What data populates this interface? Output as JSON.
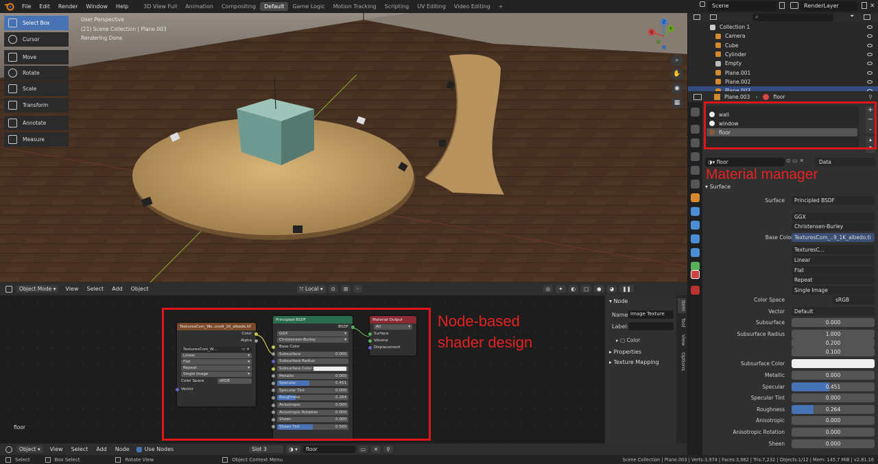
{
  "topbar": {
    "menus": [
      "File",
      "Edit",
      "Render",
      "Window",
      "Help"
    ],
    "workspaces": [
      "3D View Full",
      "Animation",
      "Compositing",
      "Default",
      "Game Logic",
      "Motion Tracking",
      "Scripting",
      "UV Editing",
      "Video Editing"
    ],
    "active_workspace": "Default",
    "add_tab": "+",
    "scene": "Scene",
    "render_layer": "RenderLayer"
  },
  "toolbar": {
    "tools": [
      "Select Box",
      "Cursor",
      "Move",
      "Rotate",
      "Scale",
      "Transform",
      "Annotate",
      "Measure"
    ],
    "active": "Select Box"
  },
  "viewport": {
    "perspective": "User Perspective",
    "collection": "(21) Scene Collection | Plane.003",
    "status": "Rendering Done",
    "gizmo_axes": [
      "Z",
      "Y",
      "X"
    ]
  },
  "viewport_header": {
    "mode": "Object Mode",
    "menus": [
      "View",
      "Select",
      "Add",
      "Object"
    ],
    "orientation": "Local"
  },
  "outliner": {
    "items": [
      {
        "name": "Collection 1"
      },
      {
        "name": "Camera"
      },
      {
        "name": "Cube"
      },
      {
        "name": "Cylinder"
      },
      {
        "name": "Empty"
      },
      {
        "name": "Plane.001"
      },
      {
        "name": "Plane.002"
      },
      {
        "name": "Plane.003"
      }
    ],
    "selected": "Plane.003"
  },
  "properties": {
    "object": "Plane.003",
    "material": "floor",
    "slots": [
      "wall",
      "window",
      "floor"
    ],
    "selected_slot": "floor",
    "mat_field": "floor",
    "link": "Data",
    "panel": "Surface",
    "rows": [
      {
        "label": "Surface",
        "value": "Principled BSDF",
        "kind": "dd"
      },
      {
        "label": "",
        "value": "GGX",
        "kind": "dd"
      },
      {
        "label": "",
        "value": "Christensen-Burley",
        "kind": "dd"
      },
      {
        "label": "Base Color",
        "value": "TexturesCom_..9_1K_albedo.ti",
        "kind": "link"
      },
      {
        "label": "",
        "value": "TexturesC...",
        "kind": "img"
      },
      {
        "label": "",
        "value": "Linear",
        "kind": "dd"
      },
      {
        "label": "",
        "value": "Flat",
        "kind": "dd"
      },
      {
        "label": "",
        "value": "Repeat",
        "kind": "dd"
      },
      {
        "label": "",
        "value": "Single Image",
        "kind": "dd"
      },
      {
        "label": "Color Space",
        "value": "sRGB",
        "kind": "dd"
      },
      {
        "label": "Vector",
        "value": "Default",
        "kind": "dd"
      },
      {
        "label": "Subsurface",
        "value": "0.000",
        "kind": "num"
      },
      {
        "label": "Subsurface Radius",
        "value": "1.000",
        "kind": "num"
      },
      {
        "label": "",
        "value": "0.200",
        "kind": "num"
      },
      {
        "label": "",
        "value": "0.100",
        "kind": "num"
      },
      {
        "label": "Subsurface Color",
        "value": "",
        "kind": "color"
      },
      {
        "label": "Metallic",
        "value": "0.000",
        "kind": "num"
      },
      {
        "label": "Specular",
        "value": "0.451",
        "kind": "bar",
        "fill": 0.451
      },
      {
        "label": "Specular Tint",
        "value": "0.000",
        "kind": "num"
      },
      {
        "label": "Roughness",
        "value": "0.264",
        "kind": "bar",
        "fill": 0.264
      },
      {
        "label": "Anisotropic",
        "value": "0.000",
        "kind": "num"
      },
      {
        "label": "Anisotropic Rotation",
        "value": "0.000",
        "kind": "num"
      },
      {
        "label": "Sheen",
        "value": "0.000",
        "kind": "num"
      }
    ]
  },
  "node_editor": {
    "material_label": "floor",
    "image_node": {
      "title": "TexturesCom_Wo..ons9_1K_albedo.tif",
      "outputs": [
        "Color",
        "Alpha"
      ],
      "image": "TexturesCom_W...",
      "fields": [
        "Linear",
        "Flat",
        "Repeat",
        "Single Image"
      ],
      "color_space_label": "Color Space",
      "color_space": "sRGB",
      "input": "Vector"
    },
    "bsdf_node": {
      "title": "Principled BSDF",
      "output": "BSDF",
      "dist": "GGX",
      "ss_method": "Christensen-Burley",
      "rows": [
        {
          "label": "Base Color",
          "value": ""
        },
        {
          "label": "Subsurface",
          "value": "0.000"
        },
        {
          "label": "Subsurface Radius",
          "value": ""
        },
        {
          "label": "Subsurface Color",
          "value": ""
        },
        {
          "label": "Metallic",
          "value": "0.000"
        },
        {
          "label": "Specular",
          "value": "0.451"
        },
        {
          "label": "Specular Tint",
          "value": "0.000"
        },
        {
          "label": "Roughness",
          "value": "0.264"
        },
        {
          "label": "Anisotropic",
          "value": "0.000"
        },
        {
          "label": "Anisotropic Rotation",
          "value": "0.000"
        },
        {
          "label": "Sheen",
          "value": "0.000"
        },
        {
          "label": "Sheen Tint",
          "value": "0.500"
        }
      ]
    },
    "output_node": {
      "title": "Material Output",
      "target": "All",
      "inputs": [
        "Surface",
        "Volume",
        "Displacement"
      ]
    },
    "side_panel": {
      "heading": "Node",
      "name_label": "Name:",
      "name_value": "Image Texture",
      "label_label": "Label:",
      "color": "Color",
      "properties": "Properties",
      "mapping": "Texture Mapping",
      "tabs": [
        "Item",
        "Tool",
        "View",
        "Options"
      ]
    }
  },
  "ne_header": {
    "mode": "Object",
    "menus": [
      "View",
      "Select",
      "Add",
      "Node"
    ],
    "use_nodes": "Use Nodes",
    "slot": "Slot 3",
    "material": "floor"
  },
  "statusbar": {
    "left": [
      "Select",
      "Box Select",
      "Rotate View",
      "Object Context Menu"
    ],
    "right": "Scene Collection | Plane.003 | Verts:3,974 | Faces:3,982 | Tris:7,232 | Objects:1/12 | Mem: 145.7 MiB | v2.81.16"
  },
  "annotations": {
    "material_manager": "Material manager",
    "node_shader_line1": "Node-based",
    "node_shader_line2": "shader design"
  },
  "colors": {
    "accent": "#4772b3",
    "annotation": "#e01515",
    "bsdf_header": "#2b6b4e",
    "output_header": "#8a2b33",
    "image_header": "#7a4a2a"
  }
}
